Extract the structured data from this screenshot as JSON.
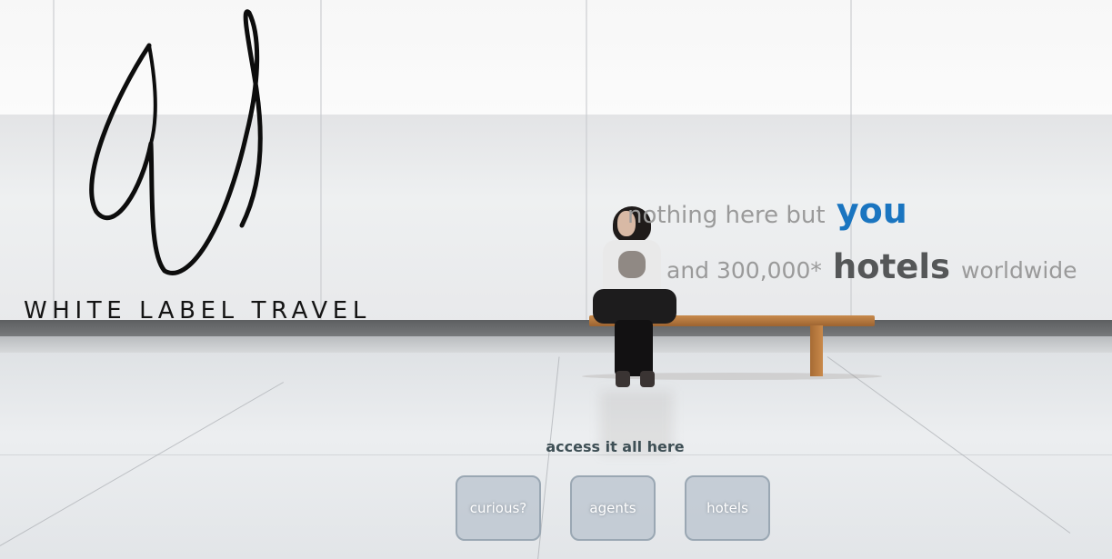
{
  "brand": {
    "name": "WHITE LABEL TRAVEL",
    "logo_icon": "w-script-logo-icon"
  },
  "tagline": {
    "line1_prefix": "nothing here but",
    "line1_emphasis": "you",
    "line2_prefix": "and 300,000*",
    "line2_emphasis": "hotels",
    "line2_suffix": "worldwide"
  },
  "access": {
    "label": "access it all here",
    "buttons": [
      {
        "label": "curious?"
      },
      {
        "label": "agents"
      },
      {
        "label": "hotels"
      }
    ]
  },
  "colors": {
    "you_accent": "#1a75c0",
    "hotels_accent": "#555758",
    "tagline_gray": "#9a9a9a",
    "access_text": "#3e4f55"
  }
}
